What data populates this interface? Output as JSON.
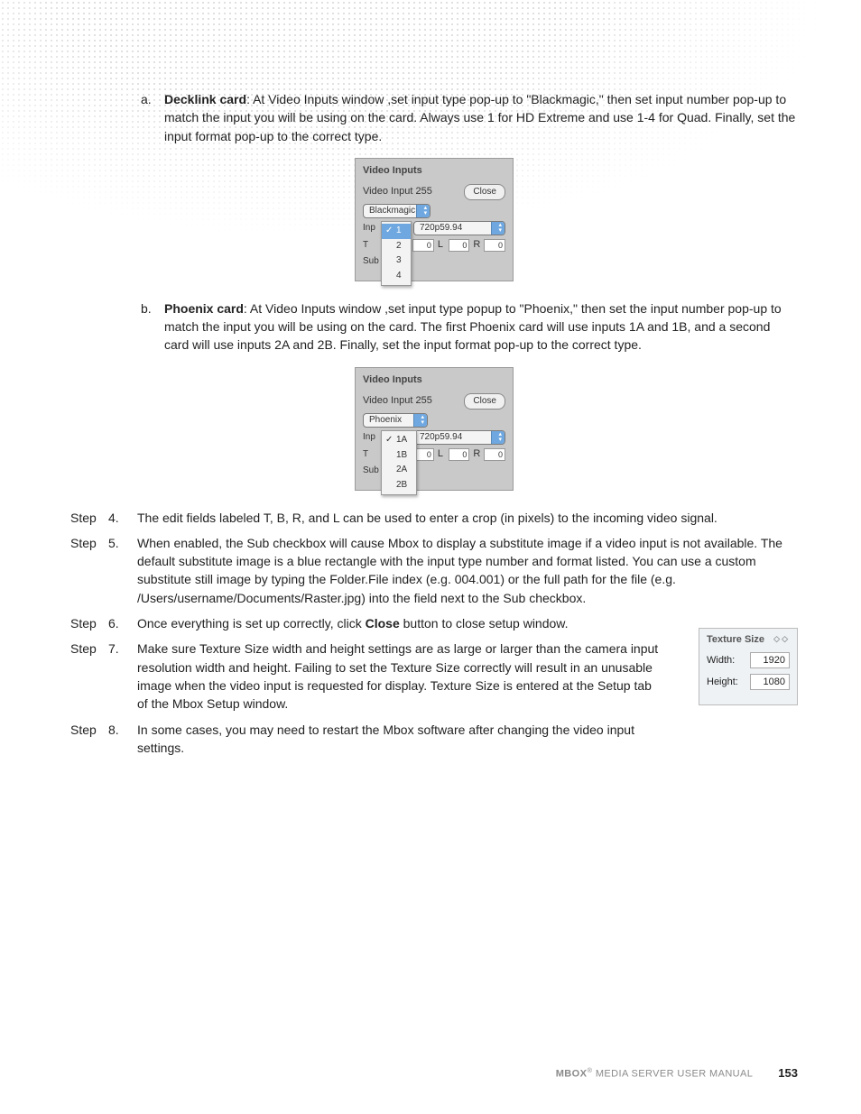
{
  "sub_a": {
    "letter": "a.",
    "heading": "Decklink card",
    "text": ": At Video Inputs window ,set input type pop-up to \"Blackmagic,\" then set input number pop-up to match the input you will be using on the card. Always use 1 for HD Extreme and use 1-4 for Quad. Finally, set the input format pop-up to the correct type."
  },
  "panel1": {
    "title": "Video Inputs",
    "input_label": "Video Input 255",
    "close": "Close",
    "type_sel": "Blackmagic",
    "inp_lbl": "Inp",
    "t_lbl": "T",
    "sub_lbl": "Sub",
    "fmt": "720p59.94",
    "l_lbl": "L",
    "r_lbl": "R",
    "zero": "0",
    "menu": [
      "1",
      "2",
      "3",
      "4"
    ]
  },
  "sub_b": {
    "letter": "b.",
    "heading": "Phoenix card",
    "text": ": At Video Inputs window ,set input type popup to \"Phoenix,\" then set the input number pop-up to match the input you will be using on the card. The first Phoenix card will use inputs 1A and 1B, and a second card will use inputs 2A and 2B. Finally, set the input format pop-up to the correct type."
  },
  "panel2": {
    "title": "Video Inputs",
    "input_label": "Video Input 255",
    "close": "Close",
    "type_sel": "Phoenix",
    "inp_lbl": "Inp",
    "t_lbl": "T",
    "sub_lbl": "Sub",
    "fmt": "720p59.94",
    "l_lbl": "L",
    "r_lbl": "R",
    "zero": "0",
    "menu": [
      "1A",
      "1B",
      "2A",
      "2B"
    ]
  },
  "steps": [
    {
      "n": "4.",
      "t": "The edit fields labeled T, B, R, and L can be used to enter a crop (in pixels) to the incoming video signal."
    },
    {
      "n": "5.",
      "t": "When enabled, the Sub checkbox will cause Mbox to display a substitute image if a video input is not available. The default substitute image is a blue rectangle with the input type number and format listed. You can use a custom substitute still image by typing the Folder.File index (e.g. 004.001) or the full path for the file (e.g. /Users/username/Documents/Raster.jpg) into the field next to the Sub checkbox."
    },
    {
      "n": "6.",
      "pre": "Once everything is set up correctly, click ",
      "bold": "Close",
      "post": " button to close setup window."
    },
    {
      "n": "7.",
      "t": "Make sure Texture Size width and height settings are as large or larger than the camera input resolution width and height. Failing to set the Texture Size correctly will result in an unusable image when the video input is requested for display. Texture Size is entered at the Setup tab of the Mbox Setup window.",
      "narrow": true
    },
    {
      "n": "8.",
      "t": "In some cases, you may need to restart the Mbox software after changing the video input settings.",
      "narrow": true
    }
  ],
  "step_label": "Step",
  "tex": {
    "title": "Texture Size",
    "w_lbl": "Width:",
    "w_val": "1920",
    "h_lbl": "Height:",
    "h_val": "1080"
  },
  "footer": {
    "text_pre": "MBOX",
    "text_post": " MEDIA SERVER USER MANUAL",
    "page": "153"
  }
}
